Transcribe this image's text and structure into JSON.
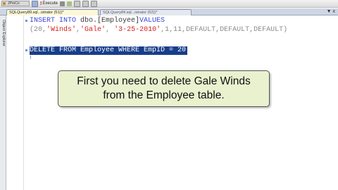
{
  "toolbar": {
    "database": "JProCo",
    "execute_label": "Execute"
  },
  "tabs": [
    {
      "label": "SQLQuery89.sql...istrator (51))*",
      "active": true
    },
    {
      "label": "SQLQuery84.sql...istrator (52))*",
      "active": false
    }
  ],
  "tab_controls": "▼ x",
  "sidebar": {
    "label": "Object Explorer"
  },
  "code": {
    "line1": {
      "kw1": "INSERT INTO",
      "obj": " dbo.[Employee]",
      "kw2": "VALUES"
    },
    "line2": {
      "open": "(20,",
      "s1": "'Winds'",
      "c1": ",",
      "s2": "'Gale'",
      "c2": ", ",
      "s3": "'3-25-2010'",
      "rest": ",1,11,DEFAULT,DEFAULT,DEFAULT)"
    },
    "selected_line": "DELETE FROM Employee WHERE EmpID = 20"
  },
  "callout": {
    "line1": "First you need to delete Gale Winds",
    "line2": "from the Employee table."
  },
  "colors": {
    "keyword": "#3a46d8",
    "string": "#d4221d",
    "selection": "#173e8a",
    "callout_bg": "#eaf1cf"
  }
}
